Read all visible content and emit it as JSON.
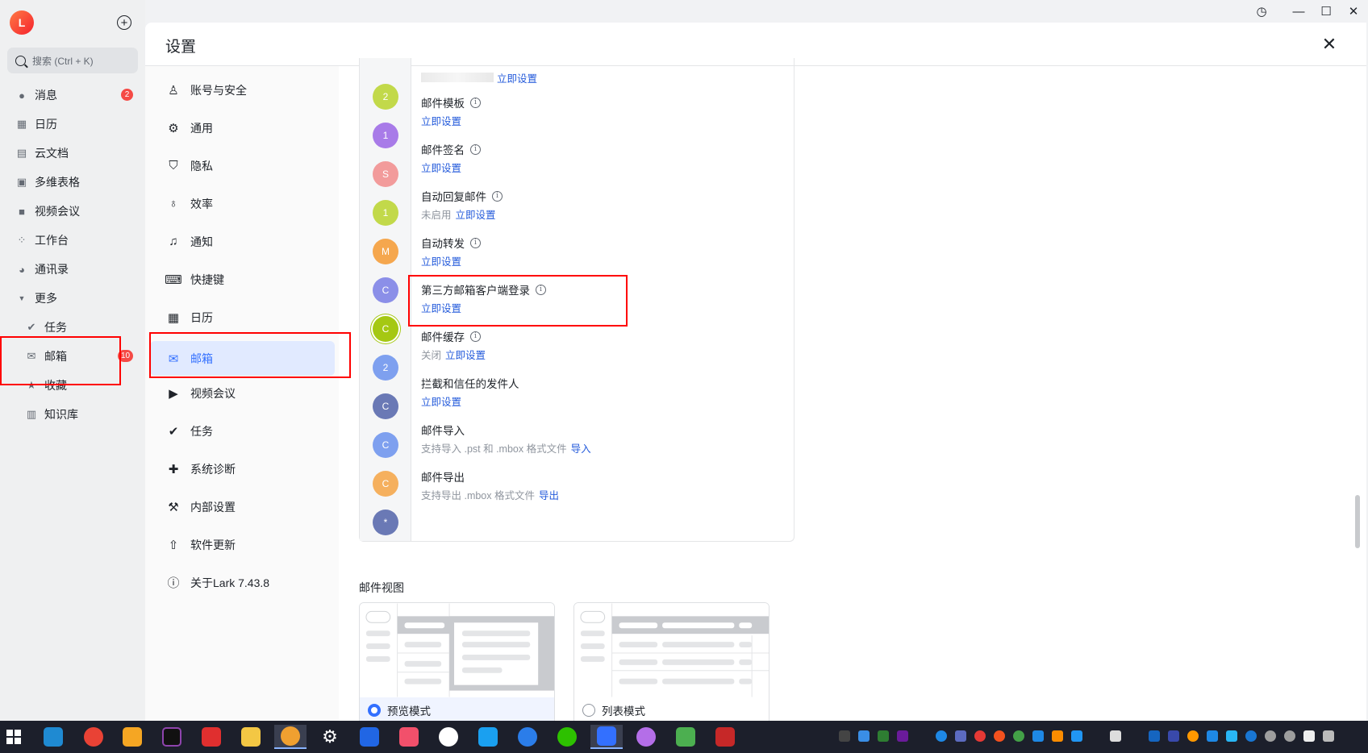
{
  "app": {
    "user_initial": "L",
    "search_placeholder": "搜索 (Ctrl + K)",
    "nav": [
      {
        "label": "消息",
        "icon": "chat-icon",
        "badge": "2"
      },
      {
        "label": "日历",
        "icon": "calendar-icon"
      },
      {
        "label": "云文档",
        "icon": "docs-icon"
      },
      {
        "label": "多维表格",
        "icon": "base-icon"
      },
      {
        "label": "视频会议",
        "icon": "video-icon"
      },
      {
        "label": "工作台",
        "icon": "workplace-icon"
      },
      {
        "label": "通讯录",
        "icon": "contacts-icon"
      },
      {
        "label": "更多",
        "icon": "expand-icon"
      },
      {
        "label": "任务",
        "icon": "task-icon"
      },
      {
        "label": "邮箱",
        "icon": "mail-icon",
        "badge": "10"
      },
      {
        "label": "收藏",
        "icon": "star-icon"
      },
      {
        "label": "知识库",
        "icon": "wiki-icon"
      }
    ]
  },
  "settings": {
    "title": "设置",
    "menu": [
      {
        "label": "账号与安全",
        "icon": "account-icon"
      },
      {
        "label": "通用",
        "icon": "gear-icon"
      },
      {
        "label": "隐私",
        "icon": "shield-icon"
      },
      {
        "label": "效率",
        "icon": "bulb-icon"
      },
      {
        "label": "通知",
        "icon": "bell-icon"
      },
      {
        "label": "快捷键",
        "icon": "keyboard-icon"
      },
      {
        "label": "日历",
        "icon": "calendar-icon"
      },
      {
        "label": "邮箱",
        "icon": "mail-icon",
        "active": true
      },
      {
        "label": "视频会议",
        "icon": "video-icon"
      },
      {
        "label": "任务",
        "icon": "task-icon"
      },
      {
        "label": "系统诊断",
        "icon": "diagnose-icon"
      },
      {
        "label": "内部设置",
        "icon": "wrench-icon"
      },
      {
        "label": "软件更新",
        "icon": "update-icon"
      },
      {
        "label": "关于Lark 7.43.8",
        "icon": "info-icon"
      }
    ],
    "mail_rows": [
      {
        "title": "",
        "sub_prefix": "",
        "link": "立即设置",
        "partial": true
      },
      {
        "title": "邮件模板",
        "sub_prefix": "",
        "link": "立即设置"
      },
      {
        "title": "邮件签名",
        "sub_prefix": "",
        "link": "立即设置"
      },
      {
        "title": "自动回复邮件",
        "sub_prefix": "未启用",
        "link": "立即设置"
      },
      {
        "title": "自动转发",
        "sub_prefix": "",
        "link": "立即设置"
      },
      {
        "title": "第三方邮箱客户端登录",
        "sub_prefix": "",
        "link": "立即设置"
      },
      {
        "title": "邮件缓存",
        "sub_prefix": "关闭",
        "link": "立即设置"
      },
      {
        "title": "拦截和信任的发件人",
        "sub_prefix": "",
        "link": "立即设置"
      },
      {
        "title": "邮件导入",
        "sub_prefix": "支持导入 .pst 和 .mbox 格式文件",
        "link": "导入"
      },
      {
        "title": "邮件导出",
        "sub_prefix": "支持导出 .mbox 格式文件",
        "link": "导出"
      }
    ],
    "account_avatars": [
      {
        "letter": "2",
        "color": "#c2d94a"
      },
      {
        "letter": "1",
        "color": "#a87be8"
      },
      {
        "letter": "S",
        "color": "#f29b9b"
      },
      {
        "letter": "1",
        "color": "#c2d94a"
      },
      {
        "letter": "M",
        "color": "#f5a74e"
      },
      {
        "letter": "C",
        "color": "#8b8fe8"
      },
      {
        "letter": "C",
        "color": "#a5c813"
      },
      {
        "letter": "2",
        "color": "#7ea0ef"
      },
      {
        "letter": "C",
        "color": "#6a79b5"
      },
      {
        "letter": "C",
        "color": "#7ea0ef"
      },
      {
        "letter": "C",
        "color": "#f5b05e"
      },
      {
        "letter": "*",
        "color": "#6a79b5"
      }
    ],
    "view_section": {
      "title": "邮件视图",
      "options": [
        {
          "label": "预览模式",
          "selected": true
        },
        {
          "label": "列表模式",
          "selected": false
        }
      ]
    }
  },
  "colors": {
    "accent": "#3370ff",
    "link": "#245bdb",
    "badge": "#f54a45",
    "highlight": "#ff0000"
  }
}
